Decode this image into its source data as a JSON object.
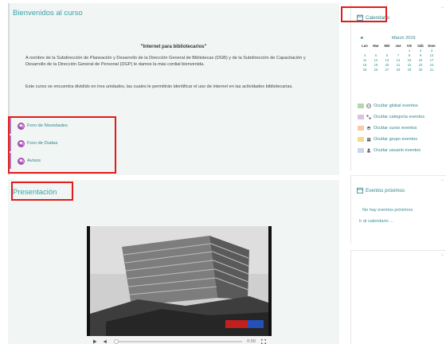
{
  "welcome": {
    "title": "Bienvenidos al curso",
    "intro_title": "\"Internet para bibliotecarios\"",
    "paragraph1": "A nombre de la Subdirección de Planeación y Desarrollo de la Dirección General de Bibliotecas (DGB) y de la Subdirección de Capacitación y Desarrollo de la Dirección General de Personal (DGP) le damos la más cordial bienvenida.",
    "paragraph2": "Este curso se encuentra dividido en tres unidades, las cuales le permitirán identificar el uso de internet en las actividades bibliotecarias."
  },
  "activities": [
    {
      "label": "Foro de Novedades",
      "icon": "forum-icon"
    },
    {
      "label": "Foro de Dudas",
      "icon": "forum-icon"
    },
    {
      "label": "Avisos",
      "icon": "forum-icon"
    }
  ],
  "presentation": {
    "title": "Presentación",
    "video_time": "0:00"
  },
  "calendar": {
    "title": "Calendario",
    "month": "March 2019",
    "prev": "◄",
    "weekdays": [
      "Lun",
      "Mar",
      "Mié",
      "Jue",
      "Vie",
      "Sáb",
      "Dom"
    ],
    "weeks": [
      [
        "",
        "",
        "",
        "",
        "1",
        "2",
        "3"
      ],
      [
        "4",
        "5",
        "6",
        "7",
        "8",
        "9",
        "10"
      ],
      [
        "11",
        "12",
        "13",
        "14",
        "15",
        "16",
        "17"
      ],
      [
        "18",
        "19",
        "20",
        "21",
        "22",
        "23",
        "24"
      ],
      [
        "25",
        "26",
        "27",
        "28",
        "29",
        "30",
        "31"
      ]
    ],
    "filters": [
      {
        "label": "Ocultar global eventos",
        "color": "#b6d7a8",
        "icon": "globe-icon"
      },
      {
        "label": "Ocultar categoría eventos",
        "color": "#d9c3e0",
        "icon": "category-icon"
      },
      {
        "label": "Ocultar curso eventos",
        "color": "#f6c9a8",
        "icon": "course-icon"
      },
      {
        "label": "Ocultar grupo eventos",
        "color": "#f4d98a",
        "icon": "group-icon"
      },
      {
        "label": "Ocultar usuario eventos",
        "color": "#c9d6e8",
        "icon": "user-icon"
      }
    ]
  },
  "events": {
    "title": "Eventos próximos",
    "empty_text": "No hay eventos próximos",
    "calendar_link": "Ir al calendario ..."
  }
}
